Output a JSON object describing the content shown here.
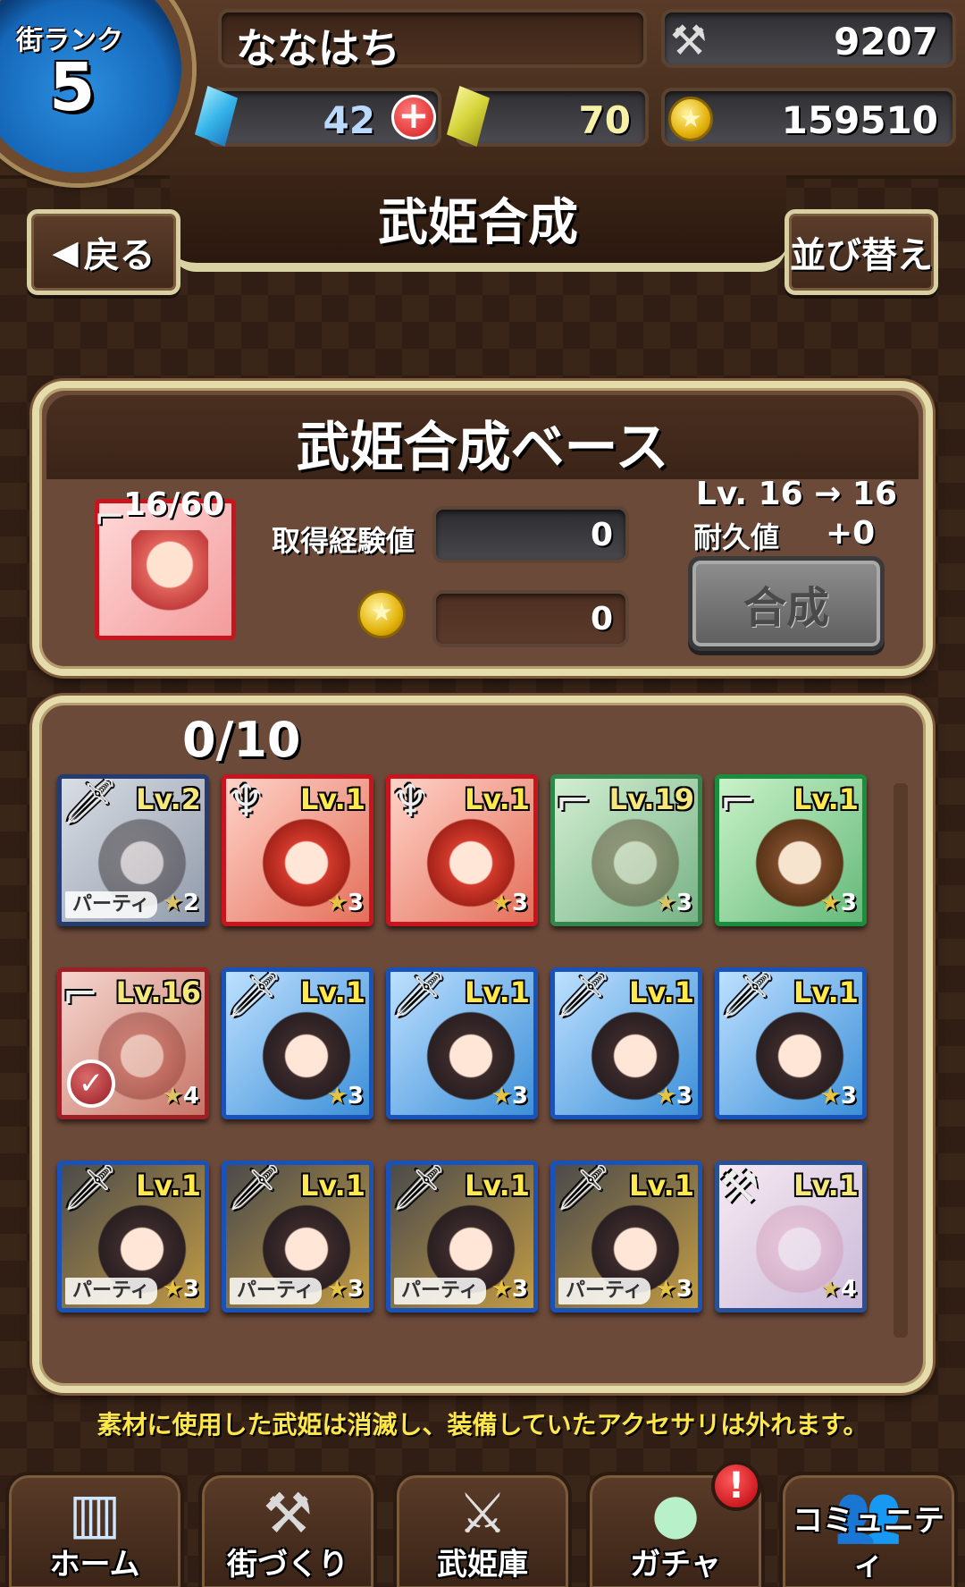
{
  "header": {
    "rank_label": "街ランク",
    "rank_value": "5",
    "player_name": "ななはち",
    "hammer_value": "9207",
    "gem_value": "42",
    "crystal_value": "70",
    "coin_value": "159510"
  },
  "nav": {
    "back_label": "戻る",
    "title": "武姫合成",
    "sort_label": "並び替え"
  },
  "base": {
    "title": "武姫合成ベース",
    "card_level": "16/60",
    "exp_label": "取得経験値",
    "exp_value": "0",
    "cost_value": "0",
    "level_change": "Lv. 16 → 16",
    "durability_label": "耐久値",
    "durability_value": "+0",
    "synth_label": "合成"
  },
  "materials": {
    "count": "0/10",
    "cards": [
      {
        "level": "Lv.2",
        "stars": "2",
        "party": "パーティ",
        "weapon": "sword-icon",
        "rarity": "silver"
      },
      {
        "level": "Lv.1",
        "stars": "3",
        "party": "",
        "weapon": "trident-icon",
        "rarity": "red"
      },
      {
        "level": "Lv.1",
        "stars": "3",
        "party": "",
        "weapon": "trident-icon",
        "rarity": "red"
      },
      {
        "level": "Lv.19",
        "stars": "3",
        "party": "",
        "weapon": "gun-icon",
        "rarity": "green"
      },
      {
        "level": "Lv.1",
        "stars": "3",
        "party": "",
        "weapon": "gun-icon",
        "rarity": "green"
      },
      {
        "level": "Lv.16",
        "stars": "4",
        "party": "",
        "weapon": "gun-icon",
        "rarity": "red",
        "checked": true
      },
      {
        "level": "Lv.1",
        "stars": "3",
        "party": "",
        "weapon": "sword-icon",
        "rarity": "blue"
      },
      {
        "level": "Lv.1",
        "stars": "3",
        "party": "",
        "weapon": "sword-icon",
        "rarity": "blue"
      },
      {
        "level": "Lv.1",
        "stars": "3",
        "party": "",
        "weapon": "sword-icon",
        "rarity": "blue"
      },
      {
        "level": "Lv.1",
        "stars": "3",
        "party": "",
        "weapon": "sword-icon",
        "rarity": "blue"
      },
      {
        "level": "Lv.1",
        "stars": "3",
        "party": "パーティ",
        "weapon": "sword-icon",
        "rarity": "gold"
      },
      {
        "level": "Lv.1",
        "stars": "3",
        "party": "パーティ",
        "weapon": "sword-icon",
        "rarity": "gold"
      },
      {
        "level": "Lv.1",
        "stars": "3",
        "party": "パーティ",
        "weapon": "sword-icon",
        "rarity": "gold"
      },
      {
        "level": "Lv.1",
        "stars": "3",
        "party": "パーティ",
        "weapon": "sword-icon",
        "rarity": "gold"
      },
      {
        "level": "Lv.1",
        "stars": "4",
        "party": "",
        "weapon": "hammer-icon",
        "rarity": "pink"
      }
    ]
  },
  "notice": "素材に使用した武姫は消滅し、装備していたアクセサリは外れます。",
  "bottom_nav": [
    {
      "label": "ホーム",
      "icon": "building-icon"
    },
    {
      "label": "街づくり",
      "icon": "tools-icon"
    },
    {
      "label": "武姫庫",
      "icon": "weapons-icon"
    },
    {
      "label": "ガチャ",
      "icon": "capsule-icon"
    },
    {
      "label": "コミュニティ",
      "icon": "people-icon"
    }
  ],
  "colors": {
    "accent_yellow": "#ffe74a",
    "rank_blue": "#1567b8",
    "frame_cream": "#e4dcaa",
    "panel_brown": "#6c4a3a"
  }
}
